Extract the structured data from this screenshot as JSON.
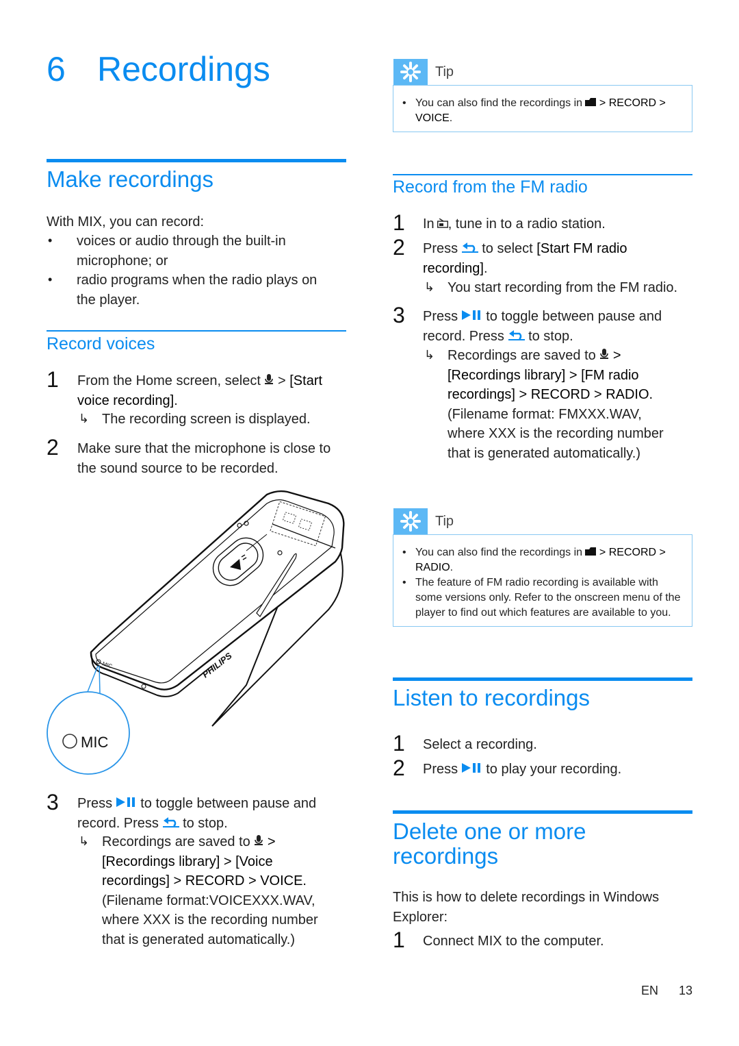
{
  "chapter": {
    "number": "6",
    "title": "Recordings"
  },
  "make_recordings": {
    "heading": "Make recordings",
    "intro": "With MIX, you can record:",
    "bullets": [
      "voices or audio through the built-in microphone; or",
      "radio programs when the radio plays on the player."
    ]
  },
  "record_voices": {
    "heading": "Record voices",
    "steps": [
      {
        "num": "1",
        "pre": "From the Home screen, select",
        "icon": "microphone-icon",
        "post_sep": ">",
        "bold": "[Start voice recording]",
        "end": ".",
        "result": "The recording screen is displayed."
      },
      {
        "num": "2",
        "text": "Make sure that the microphone is close to the sound source to be recorded."
      },
      {
        "num": "3",
        "pre": "Press",
        "icon": "play-pause-icon",
        "mid": "to toggle between pause and record. Press",
        "icon2": "back-icon",
        "post": "to stop.",
        "result_pre": "Recordings are saved to",
        "result_icon": "microphone-icon",
        "result_bold": "> [Recordings library] > [Voice recordings] > RECORD > VOICE.",
        "result_post": "(Filename format:VOICEXXX.WAV, where XXX is the recording number that is generated automatically.)"
      }
    ]
  },
  "illustration": {
    "brand": "PHILIPS",
    "mic_small": "MIC",
    "mic_callout": "MIC"
  },
  "tip_voice": {
    "label": "Tip",
    "items": [
      {
        "pre": "You can also find the recordings in",
        "icon": "folder-icon",
        "bold": "> RECORD > VOICE",
        "end": "."
      }
    ]
  },
  "record_fm": {
    "heading": "Record from the FM radio",
    "steps": [
      {
        "num": "1",
        "pre": "In",
        "icon": "radio-icon",
        "post": ", tune in to a radio station."
      },
      {
        "num": "2",
        "pre": "Press",
        "icon": "back-icon",
        "mid": "to select",
        "bold": "[Start FM radio recording]",
        "end": ".",
        "result": "You start recording from the FM radio."
      },
      {
        "num": "3",
        "pre": "Press",
        "icon": "play-pause-icon",
        "mid": "to toggle between pause and record. Press",
        "icon2": "back-icon",
        "post": "to stop.",
        "result_pre": "Recordings are saved to",
        "result_icon": "microphone-icon",
        "result_bold": "> [Recordings library] > [FM radio recordings] > RECORD > RADIO.",
        "result_post": "(Filename format: FMXXX.WAV, where XXX is the recording number that is generated automatically.)"
      }
    ]
  },
  "tip_radio": {
    "label": "Tip",
    "items": [
      {
        "pre": "You can also find the recordings in",
        "icon": "folder-icon",
        "bold": "> RECORD > RADIO",
        "end": "."
      },
      {
        "text": "The feature of FM radio recording is available with some versions only. Refer to the onscreen menu of the player to find out which features are available to you."
      }
    ]
  },
  "listen": {
    "heading": "Listen to recordings",
    "steps": [
      {
        "num": "1",
        "text": "Select a recording."
      },
      {
        "num": "2",
        "pre": "Press",
        "icon": "play-pause-icon",
        "post": "to play your recording."
      }
    ]
  },
  "delete": {
    "heading_line1": "Delete one or more",
    "heading_line2": "recordings",
    "intro": "This is how to delete recordings in Windows Explorer:",
    "steps": [
      {
        "num": "1",
        "text": "Connect MIX to the computer."
      }
    ]
  },
  "footer": {
    "lang": "EN",
    "page": "13"
  },
  "colors": {
    "accent": "#0a8cf0",
    "tip_header": "#5cb8f5",
    "tip_border": "#88c8f2"
  }
}
